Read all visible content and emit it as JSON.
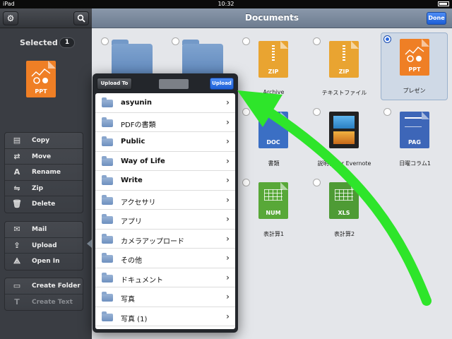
{
  "status_bar": {
    "left": "iPad",
    "time": "10:32"
  },
  "sidebar": {
    "selected_label": "Selected",
    "selected_count": "1",
    "preview_ext": "PPT",
    "preview_color": "#ef7f25",
    "group1": [
      {
        "label": "Copy",
        "icon": "copy-icon"
      },
      {
        "label": "Move",
        "icon": "move-icon"
      },
      {
        "label": "Rename",
        "icon": "rename-icon"
      },
      {
        "label": "Zip",
        "icon": "zip-icon"
      },
      {
        "label": "Delete",
        "icon": "trash-icon"
      }
    ],
    "group2": [
      {
        "label": "Mail",
        "icon": "mail-icon"
      },
      {
        "label": "Upload",
        "icon": "upload-icon"
      },
      {
        "label": "Open In",
        "icon": "open-in-icon"
      }
    ],
    "group3": [
      {
        "label": "Create Folder",
        "icon": "create-folder-icon"
      },
      {
        "label": "Create Text",
        "icon": "create-text-icon"
      }
    ]
  },
  "main": {
    "title": "Documents",
    "done_label": "Done",
    "files": [
      {
        "name": "Archive",
        "ext": "ZIP",
        "color": "#e9a431"
      },
      {
        "name": "テキストファイル",
        "ext": "ZIP",
        "color": "#e9a431"
      },
      {
        "name": "プレゼン",
        "ext": "PPT",
        "color": "#ef7f25"
      },
      {
        "name": "書類",
        "ext": "DOC",
        "color": "#3b6fc4"
      },
      {
        "name": "説明書 for Evernote",
        "ext": "",
        "color": "#222222"
      },
      {
        "name": "日曜コラム1",
        "ext": "PAG",
        "color": "#3d66b8"
      },
      {
        "name": "表計算1",
        "ext": "NUM",
        "color": "#58a838"
      },
      {
        "name": "表計算2",
        "ext": "XLS",
        "color": "#4e9b35"
      }
    ]
  },
  "popover": {
    "back_label": "Upload To",
    "upload_label": "Upload",
    "folders": [
      "asyunin",
      "PDFの書類",
      "Public",
      "Way of Life",
      "Write",
      "アクセサリ",
      "アプリ",
      "カメラアップロード",
      "その他",
      "ドキュメント",
      "写真",
      "写真 (1)"
    ]
  },
  "colors": {
    "accent_blue": "#2d6ae0",
    "arrow_green": "#2ee52a"
  }
}
